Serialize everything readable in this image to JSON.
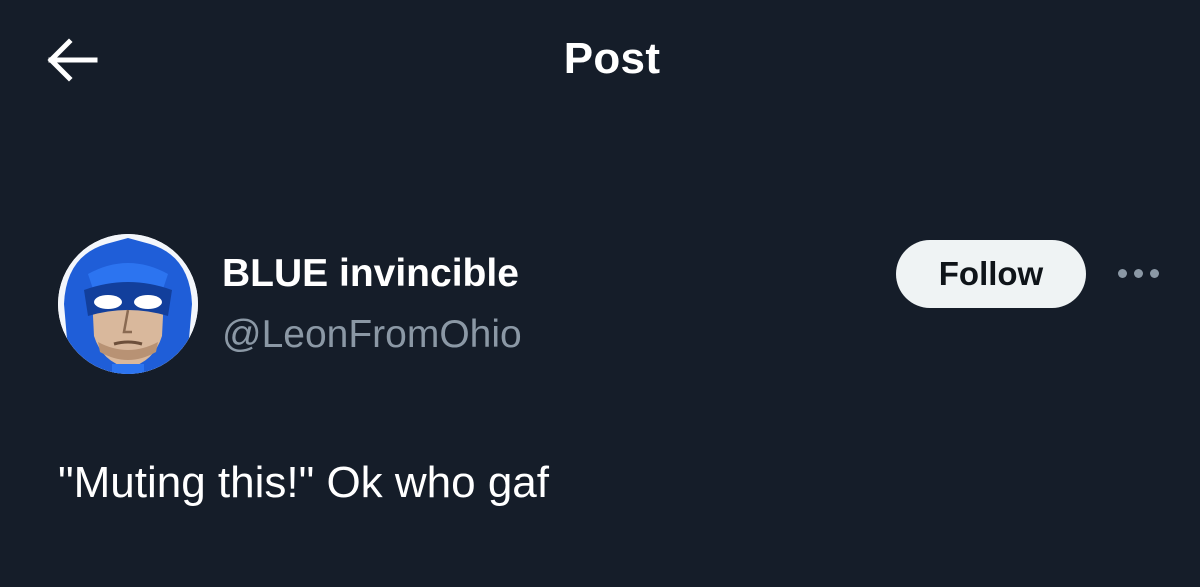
{
  "header": {
    "title": "Post",
    "back_icon": "arrow-left-icon"
  },
  "post": {
    "author": {
      "display_name": "BLUE invincible",
      "handle": "@LeonFromOhio",
      "avatar_icon": "masked-hero-avatar"
    },
    "follow_label": "Follow",
    "more_icon": "more-options-icon",
    "text": "\"Muting this!\" Ok who gaf"
  },
  "colors": {
    "background": "#151d29",
    "primary_text": "#ffffff",
    "secondary_text": "#8b98a5",
    "follow_button_bg": "#eff3f4",
    "follow_button_text": "#0f1419",
    "avatar_mask_blue": "#1f5ed8"
  }
}
